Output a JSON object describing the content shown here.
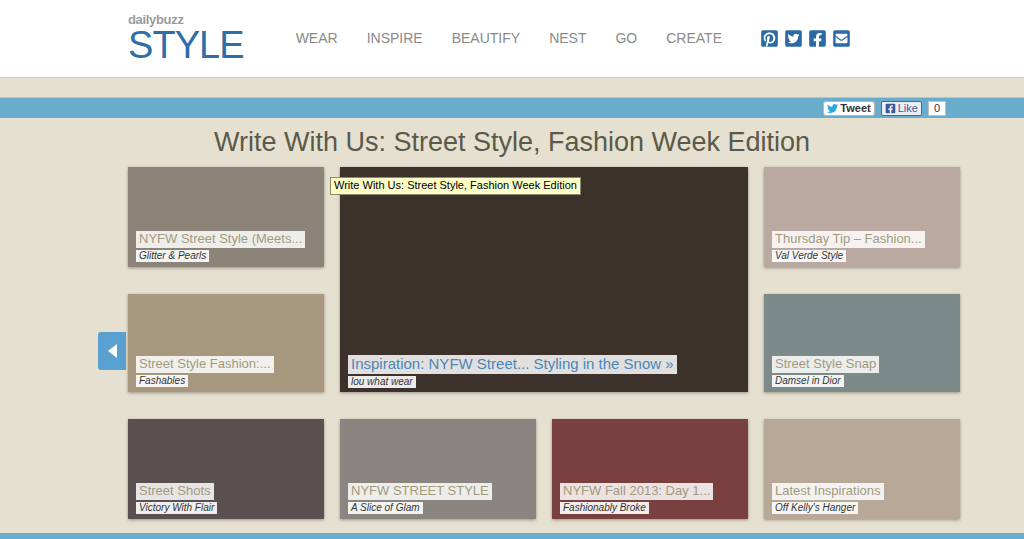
{
  "logo": {
    "small": "dailybuzz",
    "big": "STYLE"
  },
  "nav": [
    "WEAR",
    "INSPIRE",
    "BEAUTIFY",
    "NEST",
    "GO",
    "CREATE"
  ],
  "share": {
    "tweet": "Tweet",
    "like": "Like",
    "like_count": "0"
  },
  "title": "Write With Us: Street Style, Fashion Week Edition",
  "tooltip": "Write With Us: Street Style, Fashion Week Edition",
  "tiles": [
    {
      "title": "NYFW Street Style (Meets...",
      "source": "Glitter & Pearls",
      "featured": false
    },
    {
      "title": "Inspiration: NYFW Street... Styling in the Snow »",
      "source": "lou what wear",
      "featured": true
    },
    {
      "title": "Thursday Tip – Fashion...",
      "source": "Val Verde Style",
      "featured": false
    },
    {
      "title": "Street Style Fashion:...",
      "source": "Fashables",
      "featured": false
    },
    {
      "title": "Street Style Snap",
      "source": "Damsel in Dior",
      "featured": false
    },
    {
      "title": "Street Shots",
      "source": "Victory With Flair",
      "featured": false
    },
    {
      "title": "NYFW STREET STYLE",
      "source": "A Slice of Glam",
      "featured": false
    },
    {
      "title": "NYFW Fall 2013: Day 1...",
      "source": "Fashionably Broke",
      "featured": false
    },
    {
      "title": "Latest Inspirations",
      "source": "Off Kelly's Hanger",
      "featured": false
    }
  ]
}
